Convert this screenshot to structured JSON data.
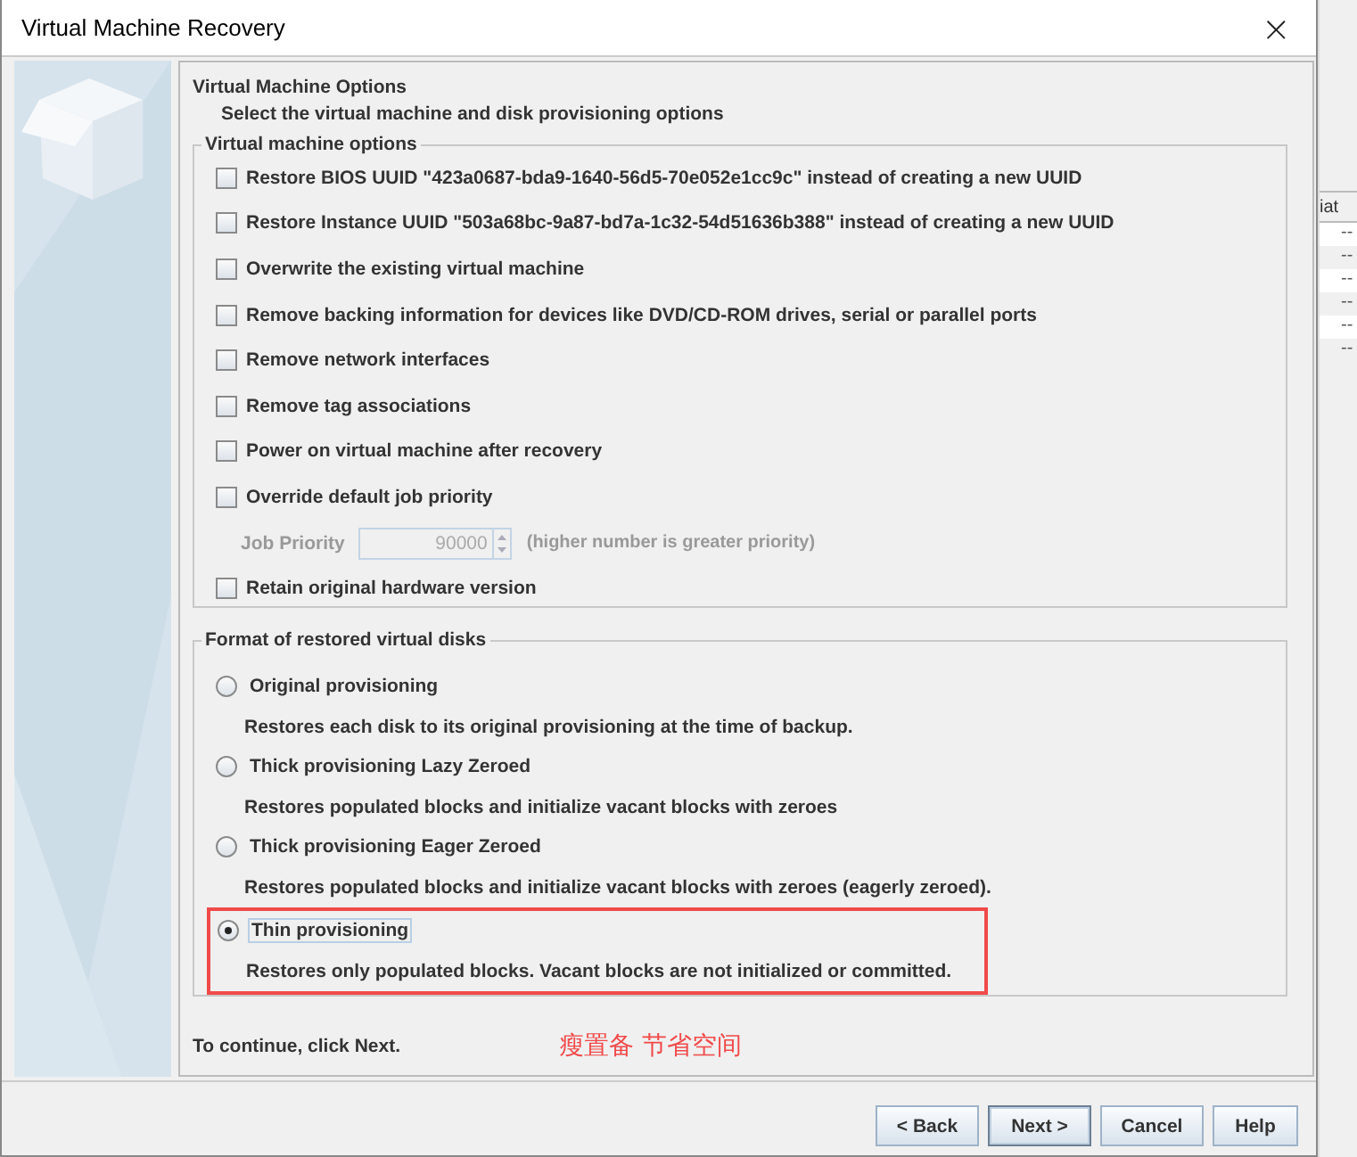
{
  "window": {
    "title": "Virtual Machine Recovery",
    "close": "×"
  },
  "header": {
    "title": "Virtual Machine Options",
    "subtitle": "Select the virtual machine and disk provisioning options"
  },
  "vm_options": {
    "legend": "Virtual machine options",
    "items": [
      {
        "kind": "checkbox",
        "label": "Restore BIOS UUID \"423a0687-bda9-1640-56d5-70e052e1cc9c\" instead of creating a new UUID",
        "checked": false
      },
      {
        "kind": "checkbox",
        "label": "Restore Instance UUID \"503a68bc-9a87-bd7a-1c32-54d51636b388\" instead of creating a new UUID",
        "checked": false
      },
      {
        "kind": "checkbox",
        "label": "Overwrite the existing virtual machine",
        "checked": false
      },
      {
        "kind": "checkbox",
        "label": "Remove backing information for devices like DVD/CD-ROM drives, serial or parallel ports",
        "checked": false
      },
      {
        "kind": "checkbox",
        "label": "Remove network interfaces",
        "checked": false
      },
      {
        "kind": "checkbox",
        "label": "Remove tag associations",
        "checked": false
      },
      {
        "kind": "checkbox",
        "label": "Power on virtual machine after recovery",
        "checked": false
      },
      {
        "kind": "checkbox",
        "label": "Override default job priority",
        "checked": false
      },
      {
        "kind": "spinner",
        "label": "Job Priority",
        "value": "90000",
        "hint": "(higher number is greater priority)",
        "disabled": true
      },
      {
        "kind": "checkbox",
        "label": "Retain original hardware version",
        "checked": false
      }
    ]
  },
  "disk_format": {
    "legend": "Format of restored virtual disks",
    "items": [
      {
        "label": "Original provisioning",
        "description": "Restores each disk to its original provisioning at the time of backup.",
        "selected": false,
        "highlighted": false
      },
      {
        "label": "Thick provisioning Lazy Zeroed",
        "description": "Restores populated blocks and initialize vacant blocks with zeroes",
        "selected": false,
        "highlighted": false
      },
      {
        "label": "Thick provisioning Eager Zeroed",
        "description": "Restores populated blocks and initialize vacant blocks with zeroes (eagerly zeroed).",
        "selected": false,
        "highlighted": false
      },
      {
        "label": "Thin provisioning",
        "description": "Restores only populated blocks. Vacant blocks are not initialized or committed.",
        "selected": true,
        "highlighted": true
      }
    ]
  },
  "footer": {
    "hint": "To continue, click Next.",
    "annotation": "瘦置备 节省空间"
  },
  "buttons": [
    {
      "label": "< Back",
      "default": false
    },
    {
      "label": "Next >",
      "default": true
    },
    {
      "label": "Cancel",
      "default": false
    },
    {
      "label": "Help",
      "default": false
    }
  ],
  "background_table": {
    "column_header": "iat",
    "cells": [
      "--",
      "--",
      "--",
      "--",
      "--",
      "--"
    ]
  }
}
